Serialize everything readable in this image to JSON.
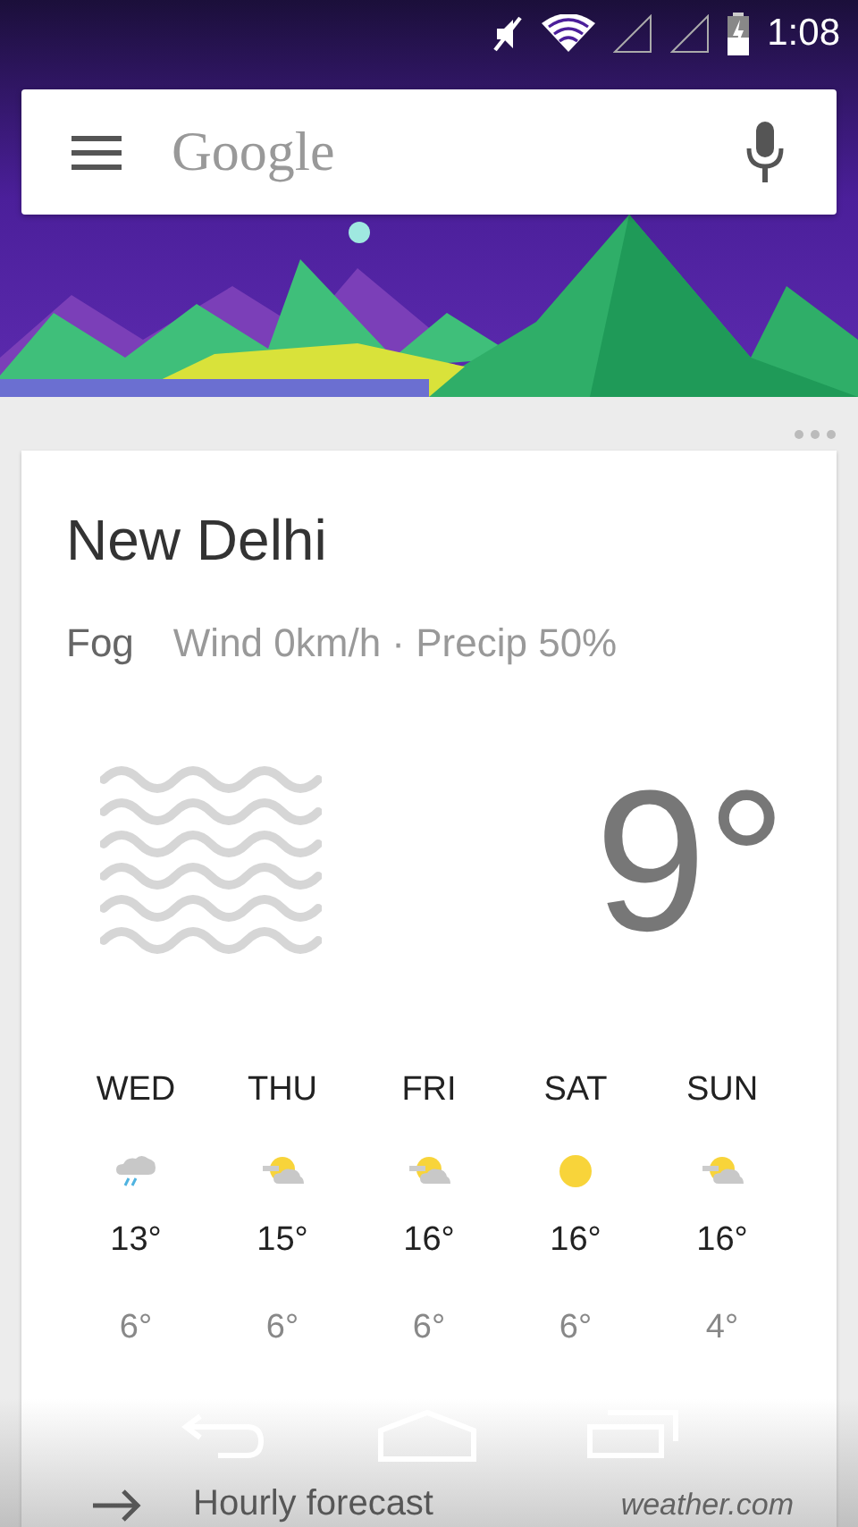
{
  "status_bar": {
    "time": "1:08"
  },
  "search": {
    "logo": "Google"
  },
  "weather": {
    "city": "New Delhi",
    "condition": "Fog",
    "details": "Wind 0km/h · Precip 50%",
    "current_icon": {
      "kind": "fog"
    },
    "temperature": "9°",
    "forecast": [
      {
        "day": "WED",
        "kind": "rain",
        "high": "13°",
        "low": "6°"
      },
      {
        "day": "THU",
        "kind": "partly-sunny",
        "high": "15°",
        "low": "6°"
      },
      {
        "day": "FRI",
        "kind": "partly-sunny",
        "high": "16°",
        "low": "6°"
      },
      {
        "day": "SAT",
        "kind": "sunny",
        "high": "16°",
        "low": "6°"
      },
      {
        "day": "SUN",
        "kind": "partly-sunny",
        "high": "16°",
        "low": "4°"
      }
    ],
    "footer": {
      "action": "Hourly forecast",
      "source": "weather.com"
    }
  }
}
